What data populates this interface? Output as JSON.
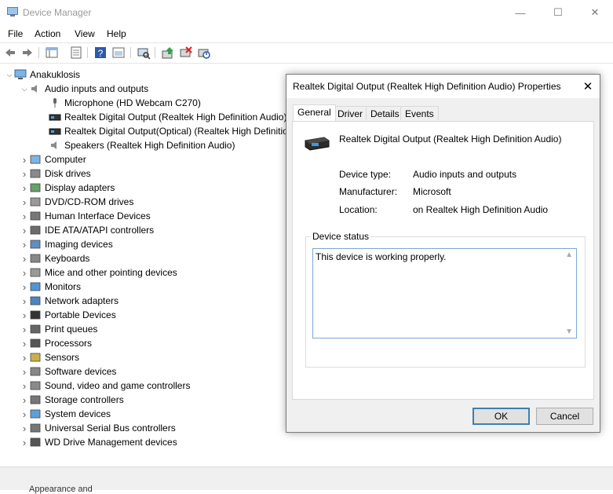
{
  "window": {
    "title": "Device Manager",
    "minimize": "—",
    "maximize": "☐",
    "close": "✕"
  },
  "menu": [
    "File",
    "Action",
    "View",
    "Help"
  ],
  "toolbar": {
    "buttons": [
      "back-icon",
      "forward-icon",
      "show-hide-icon",
      "properties-icon",
      "help-icon",
      "view-icon",
      "scan-hardware-icon",
      "update-driver-icon",
      "uninstall-icon",
      "disable-icon"
    ]
  },
  "tree": {
    "root": "Anakuklosis",
    "audio": {
      "label": "Audio inputs and outputs",
      "children": [
        "Microphone (HD Webcam C270)",
        "Realtek Digital Output (Realtek High Definition Audio)",
        "Realtek Digital Output(Optical) (Realtek High Definition Audio)",
        "Speakers (Realtek High Definition Audio)"
      ]
    },
    "categories": [
      "Computer",
      "Disk drives",
      "Display adapters",
      "DVD/CD-ROM drives",
      "Human Interface Devices",
      "IDE ATA/ATAPI controllers",
      "Imaging devices",
      "Keyboards",
      "Mice and other pointing devices",
      "Monitors",
      "Network adapters",
      "Portable Devices",
      "Print queues",
      "Processors",
      "Sensors",
      "Software devices",
      "Sound, video and game controllers",
      "Storage controllers",
      "System devices",
      "Universal Serial Bus controllers",
      "WD Drive Management devices"
    ]
  },
  "status_fragment": "Appearance and",
  "dialog": {
    "title": "Realtek Digital Output (Realtek High Definition Audio) Properties",
    "close": "✕",
    "tabs": [
      "General",
      "Driver",
      "Details",
      "Events"
    ],
    "active_tab": "General",
    "device_name": "Realtek Digital Output (Realtek High Definition Audio)",
    "props": [
      {
        "label": "Device type:",
        "value": "Audio inputs and outputs"
      },
      {
        "label": "Manufacturer:",
        "value": "Microsoft"
      },
      {
        "label": "Location:",
        "value": "on Realtek High Definition Audio"
      }
    ],
    "status_group": "Device status",
    "status_text": "This device is working properly.",
    "ok": "OK",
    "cancel": "Cancel"
  }
}
